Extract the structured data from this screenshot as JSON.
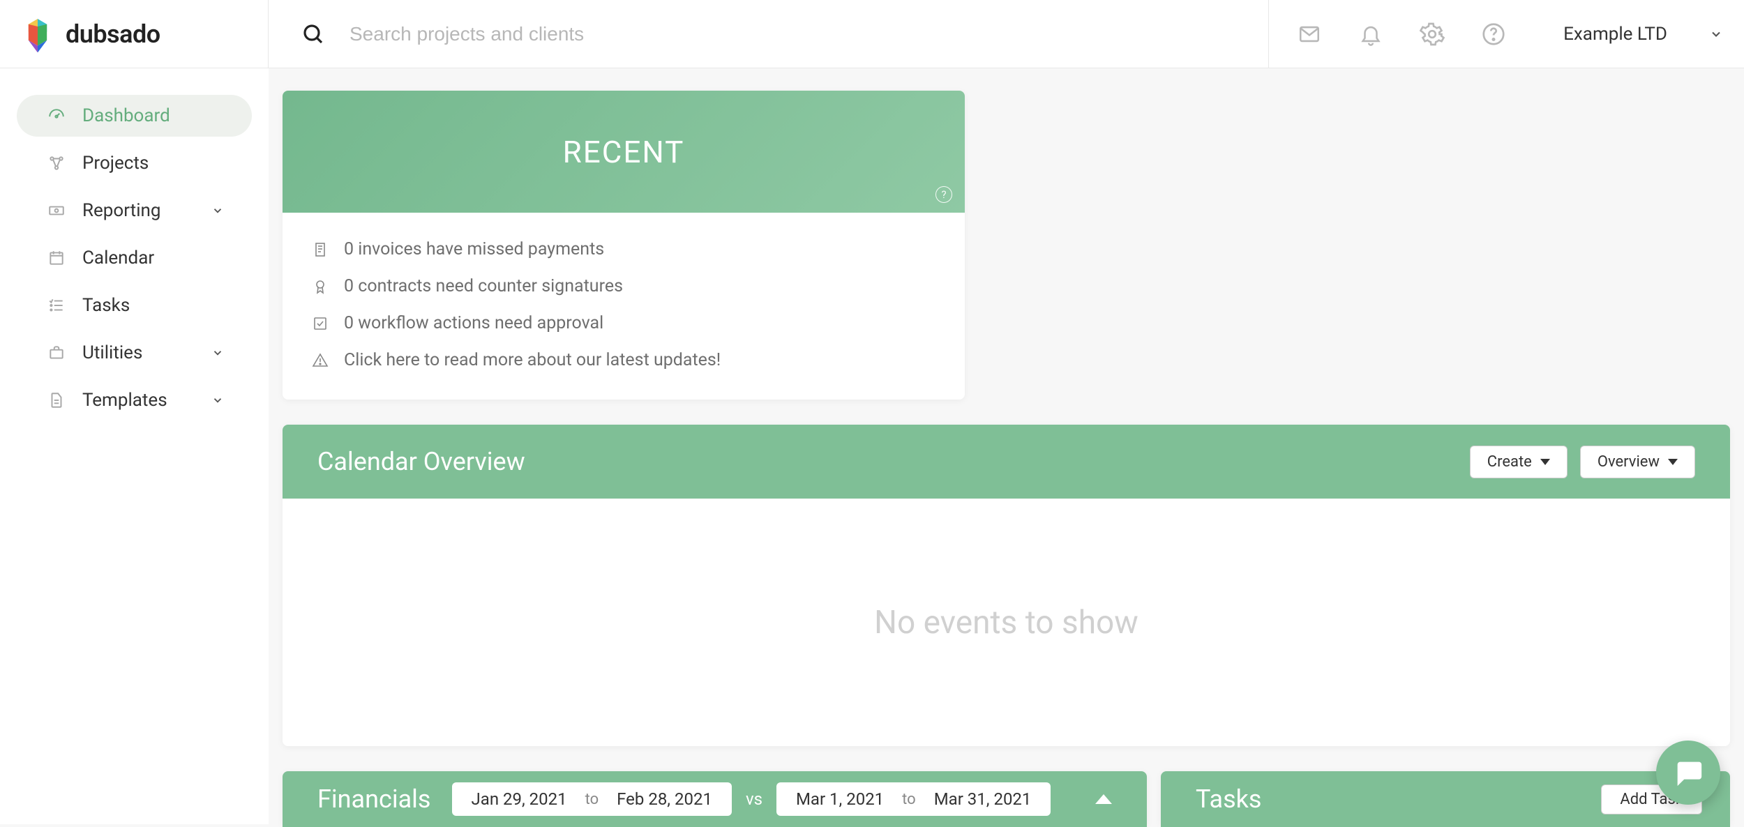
{
  "header": {
    "logo_text": "dubsado",
    "search_placeholder": "Search projects and clients",
    "brand_name": "Example LTD"
  },
  "sidebar": {
    "items": [
      {
        "label": "Dashboard",
        "has_chevron": false
      },
      {
        "label": "Projects",
        "has_chevron": false
      },
      {
        "label": "Reporting",
        "has_chevron": true
      },
      {
        "label": "Calendar",
        "has_chevron": false
      },
      {
        "label": "Tasks",
        "has_chevron": false
      },
      {
        "label": "Utilities",
        "has_chevron": true
      },
      {
        "label": "Templates",
        "has_chevron": true
      }
    ]
  },
  "recent": {
    "title": "RECENT",
    "rows": [
      "0 invoices have missed payments",
      "0 contracts need counter signatures",
      "0 workflow actions need approval",
      "Click here to read more about our latest updates!"
    ]
  },
  "calendar": {
    "title": "Calendar Overview",
    "create_label": "Create",
    "overview_label": "Overview",
    "empty_text": "No events to show"
  },
  "financials": {
    "title": "Financials",
    "range1_from": "Jan 29, 2021",
    "range1_to": "Feb 28, 2021",
    "range_sep": "to",
    "vs": "vs",
    "range2_from": "Mar 1, 2021",
    "range2_to": "Mar 31, 2021"
  },
  "tasks": {
    "title": "Tasks",
    "add_label": "Add Task"
  }
}
